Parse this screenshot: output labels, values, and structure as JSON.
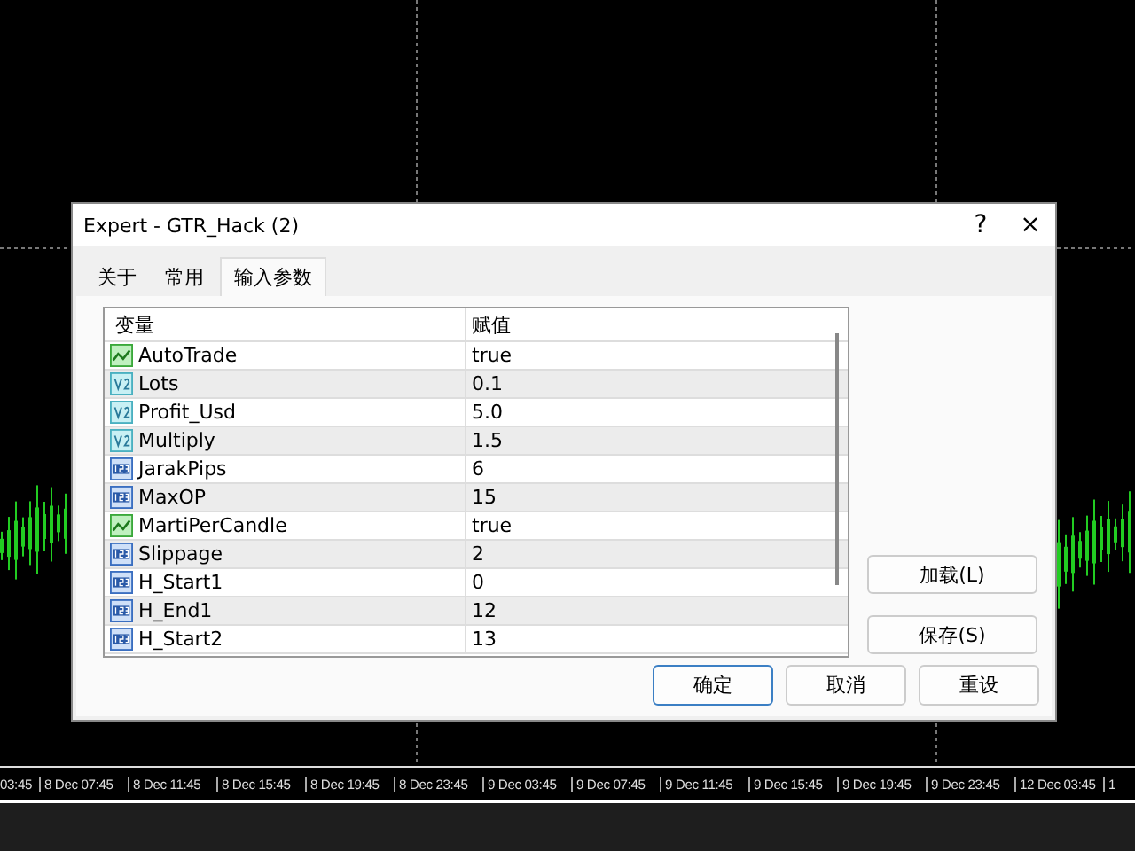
{
  "time_axis": [
    "03:45",
    "8 Dec 07:45",
    "8 Dec 11:45",
    "8 Dec 15:45",
    "8 Dec 19:45",
    "8 Dec 23:45",
    "9 Dec 03:45",
    "9 Dec 07:45",
    "9 Dec 11:45",
    "9 Dec 15:45",
    "9 Dec 19:45",
    "9 Dec 23:45",
    "12 Dec 03:45",
    "1"
  ],
  "window": {
    "title": "Expert - GTR_Hack (2)",
    "help": "?",
    "close": "×"
  },
  "tabs": [
    {
      "label": "关于",
      "selected": false
    },
    {
      "label": "常用",
      "selected": false
    },
    {
      "label": "输入参数",
      "selected": true
    }
  ],
  "table": {
    "columns": [
      "变量",
      "赋值"
    ],
    "rows": [
      {
        "kind": "bool",
        "name": "AutoTrade",
        "value": "true"
      },
      {
        "kind": "double",
        "name": "Lots",
        "value": "0.1"
      },
      {
        "kind": "double",
        "name": "Profit_Usd",
        "value": "5.0"
      },
      {
        "kind": "double",
        "name": "Multiply",
        "value": "1.5"
      },
      {
        "kind": "int",
        "name": "JarakPips",
        "value": "6"
      },
      {
        "kind": "int",
        "name": "MaxOP",
        "value": "15"
      },
      {
        "kind": "bool",
        "name": "MartiPerCandle",
        "value": "true"
      },
      {
        "kind": "int",
        "name": "Slippage",
        "value": "2"
      },
      {
        "kind": "int",
        "name": "H_Start1",
        "value": "0"
      },
      {
        "kind": "int",
        "name": "H_End1",
        "value": "12"
      },
      {
        "kind": "int",
        "name": "H_Start2",
        "value": "13"
      }
    ]
  },
  "side_buttons": [
    "加载(L)",
    "保存(S)"
  ],
  "buttons": [
    {
      "label": "确定",
      "default": true
    },
    {
      "label": "取消",
      "default": false
    },
    {
      "label": "重设",
      "default": false
    }
  ]
}
